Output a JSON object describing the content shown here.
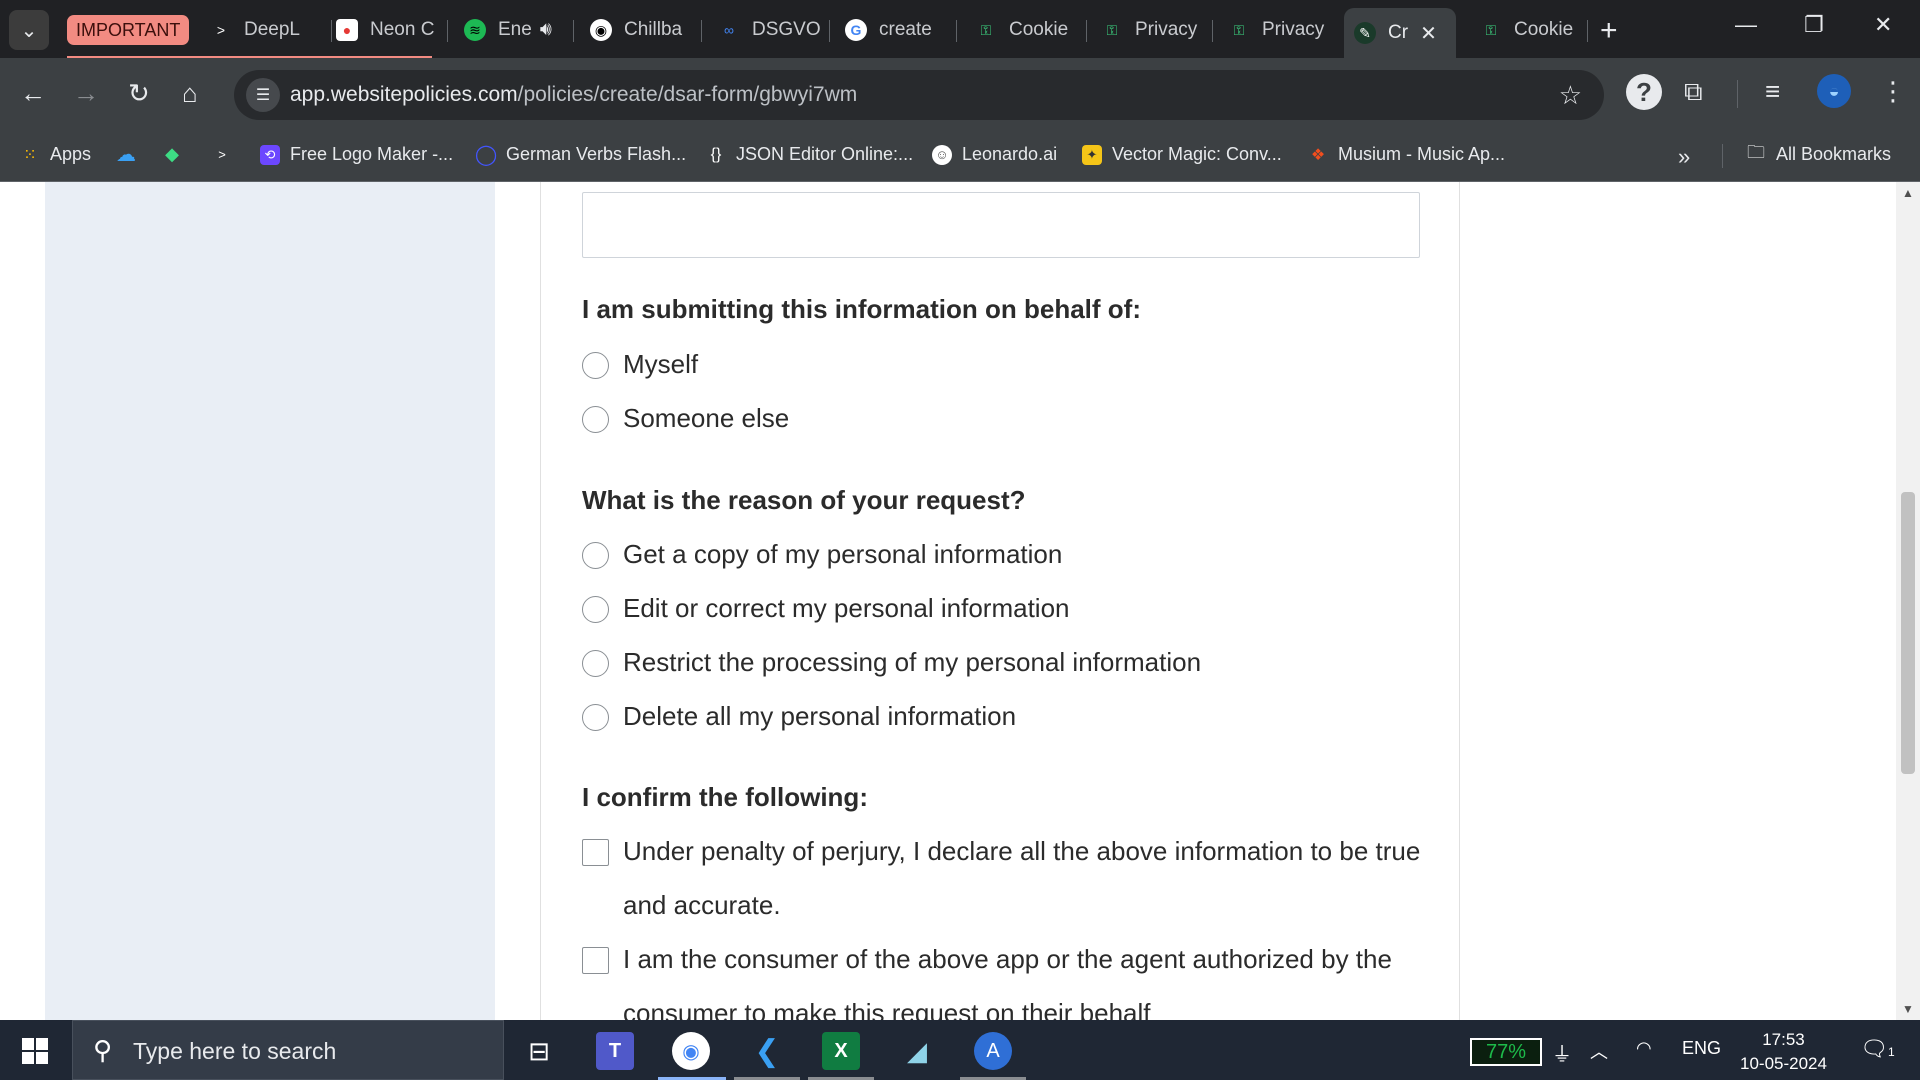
{
  "tabs": [
    {
      "label": "IMPORTANT",
      "type": "group"
    },
    {
      "label": "DeepL",
      "icon": "deepl-icon"
    },
    {
      "label": "Neon C",
      "icon": "neon-icon"
    },
    {
      "label": "Ene",
      "icon": "spotify-icon"
    },
    {
      "label": "Chillba",
      "icon": "github-icon"
    },
    {
      "label": "DSGVO",
      "icon": "dsgvo-icon"
    },
    {
      "label": "create",
      "icon": "google-icon"
    },
    {
      "label": "Cookie",
      "icon": "key-icon"
    },
    {
      "label": "Privacy",
      "icon": "key-icon"
    },
    {
      "label": "Privacy",
      "icon": "key-icon"
    },
    {
      "label": "Cr",
      "icon": "websitepolicies-icon",
      "active": true
    },
    {
      "label": "Cookie",
      "icon": "key-icon"
    }
  ],
  "address_bar": {
    "host": "app.websitepolicies.com",
    "path": "/policies/create/dsar-form/gbwyi7wm"
  },
  "bookmarks": {
    "apps": "Apps",
    "items": [
      "Free Logo Maker -...",
      "German Verbs Flash...",
      "JSON Editor Online:...",
      "Leonardo.ai",
      "Vector Magic: Conv...",
      "Musium - Music Ap..."
    ],
    "all": "All Bookmarks"
  },
  "form": {
    "behalf": {
      "question": "I am submitting this information on behalf of:",
      "options": [
        "Myself",
        "Someone else"
      ]
    },
    "reason": {
      "question": "What is the reason of your request?",
      "options": [
        "Get a copy of my personal information",
        "Edit or correct my personal information",
        "Restrict the processing of my personal information",
        "Delete all my personal information"
      ]
    },
    "confirm": {
      "question": "I confirm the following:",
      "options": [
        "Under penalty of perjury, I declare all the above information to be true and accurate.",
        "I am the consumer of the above app or the agent authorized by the consumer to make this request on their behalf"
      ]
    }
  },
  "taskbar": {
    "search_placeholder": "Type here to search",
    "battery": "77%",
    "language": "ENG",
    "time": "17:53",
    "date": "10-05-2024",
    "notifications": "1"
  }
}
